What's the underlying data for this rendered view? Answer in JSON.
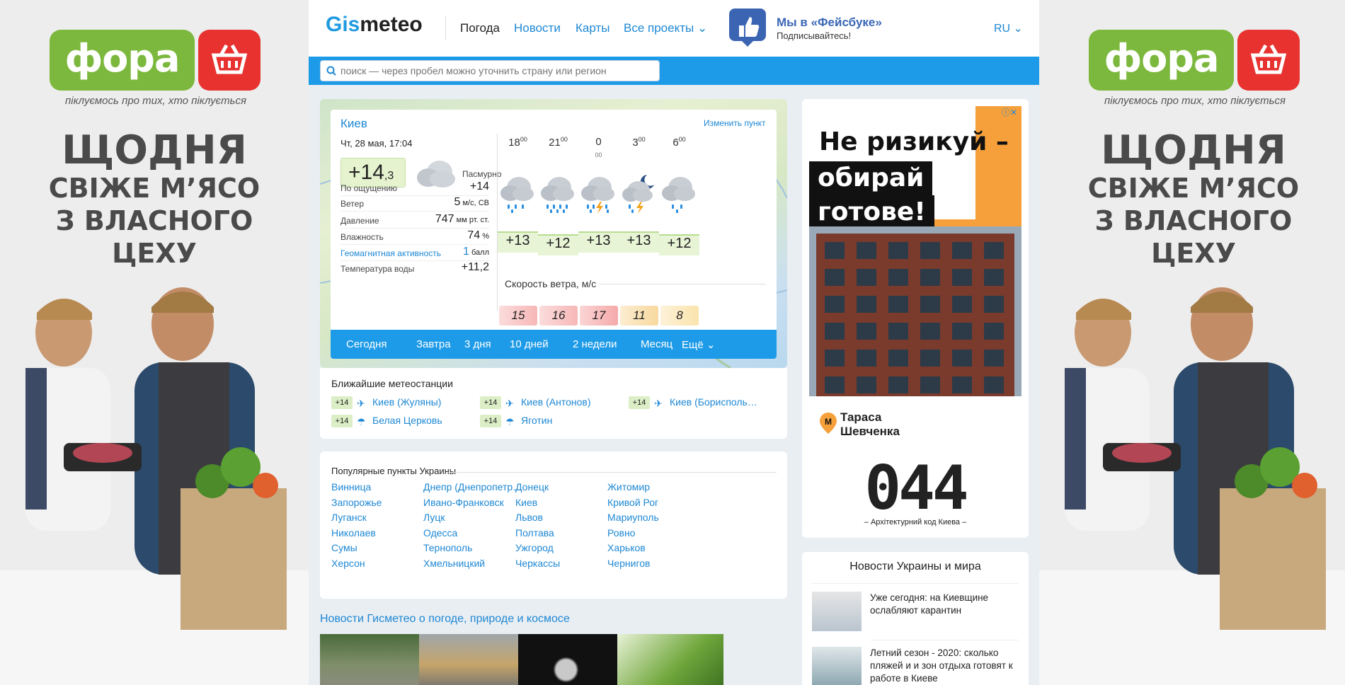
{
  "colors": {
    "accent": "#1e9be8",
    "link": "#1e88d4",
    "temp_bg": "#e8f4d6",
    "ad_orange": "#f6a03b",
    "fora_green": "#7cb83d",
    "fora_red": "#e7322f"
  },
  "side_ad": {
    "brand": "фора",
    "slogan": "піклуємось про тих, хто піклується",
    "headline": [
      "ЩОДНЯ",
      "СВІЖЕ М’ЯСО",
      "З ВЛАСНОГО",
      "ЦЕХУ"
    ],
    "icon": "basket-icon"
  },
  "header": {
    "brand_a": "Gis",
    "brand_b": "meteo",
    "nav": [
      "Погода",
      "Новости",
      "Карты",
      "Все проекты ⌄"
    ],
    "fb_title": "Мы в «Фейсбуке»",
    "fb_sub": "Подписывайтесь!",
    "lang": "RU ⌄"
  },
  "search": {
    "placeholder": "поиск — через пробел можно уточнить страну или регион"
  },
  "weather": {
    "city": "Киев",
    "change": "Изменить пункт",
    "date": "Чт, 28 мая, 17:04",
    "temp_main": "+14",
    "temp_frac": ",3",
    "condition": "Пасмурно",
    "details": [
      {
        "label": "По ощущению",
        "value": "+14",
        "unit": ""
      },
      {
        "label": "Ветер",
        "value": "5",
        "unit": " м/с, СВ"
      },
      {
        "label": "Давление",
        "value": "747",
        "unit": " мм рт. ст."
      },
      {
        "label": "Влажность",
        "value": "74",
        "unit": " %"
      },
      {
        "label": "Геомагнитная активность",
        "value": "1",
        "unit": " балл"
      },
      {
        "label": "Температура воды",
        "value": "+11,2",
        "unit": ""
      }
    ],
    "hours": [
      {
        "h": "18",
        "m": "00",
        "temp": "+13",
        "wind": "15",
        "icon": "rain-cloud-icon"
      },
      {
        "h": "21",
        "m": "00",
        "temp": "+12",
        "wind": "16",
        "icon": "rain-cloud-icon"
      },
      {
        "h": "0",
        "m": "00",
        "temp": "+13",
        "wind": "17",
        "icon": "thunder-rain-icon"
      },
      {
        "h": "3",
        "m": "00",
        "temp": "+13",
        "wind": "11",
        "icon": "night-thunder-icon"
      },
      {
        "h": "6",
        "m": "00",
        "temp": "+12",
        "wind": "8",
        "icon": "rain-cloud-icon"
      }
    ],
    "wind_label": "Скорость ветра, м/с",
    "tabs": [
      "Сегодня",
      "Завтра",
      "3 дня",
      "10 дней",
      "2 недели",
      "Месяц",
      "Ещё ⌄"
    ]
  },
  "stations": {
    "title": "Ближайшие метеостанции",
    "items": [
      {
        "temp": "+14",
        "name": "Киев (Жуляны)"
      },
      {
        "temp": "+14",
        "name": "Киев (Антонов)"
      },
      {
        "temp": "+14",
        "name": "Киев (Борисполь…"
      },
      {
        "temp": "+14",
        "name": "Белая Церковь"
      },
      {
        "temp": "+14",
        "name": "Яготин"
      }
    ]
  },
  "popular": {
    "title": "Популярные пункты Украины",
    "columns": [
      [
        "Винница",
        "Запорожье",
        "Луганск",
        "Николаев",
        "Сумы",
        "Херсон"
      ],
      [
        "Днепр (Днепропетр…",
        "Ивано-Франковск",
        "Луцк",
        "Одесса",
        "Тернополь",
        "Хмельницкий"
      ],
      [
        "Донецк",
        "Киев",
        "Львов",
        "Полтава",
        "Ужгород",
        "Черкассы"
      ],
      [
        "Житомир",
        "Кривой Рог",
        "Мариуполь",
        "Ровно",
        "Харьков",
        "Чернигов"
      ]
    ]
  },
  "gis_news": {
    "title": "Новости Гисметео о погоде, природе и космосе"
  },
  "ad_right": {
    "line1": "Не ризикуй –",
    "line2": "обирай",
    "line3": "готове!",
    "metro": "Тараса\nШевченка",
    "code": "044",
    "tagline": "– Архітектурний код Киева –"
  },
  "news_box": {
    "title": "Новости Украины и мира",
    "items": [
      "Уже сегодня: на Киевщине ослабляют карантин",
      "Летний сезон - 2020: сколько пляжей и и зон отдыха готовят к работе в Киеве"
    ]
  }
}
